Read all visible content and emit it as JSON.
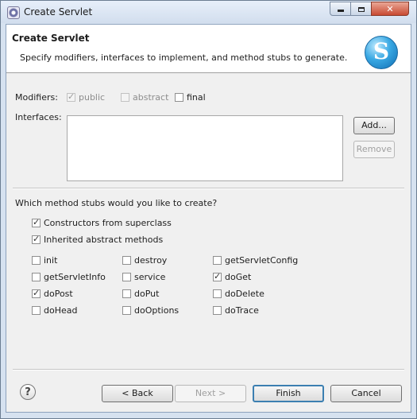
{
  "window": {
    "title": "Create Servlet",
    "controls": {
      "minimize": "",
      "maximize": "",
      "close": "✕"
    }
  },
  "banner": {
    "title": "Create Servlet",
    "description": "Specify modifiers, interfaces to implement, and method stubs to generate.",
    "logo_letter": "S"
  },
  "modifiers": {
    "label": "Modifiers:",
    "public": {
      "label": "public",
      "checked": true,
      "enabled": false
    },
    "abstract": {
      "label": "abstract",
      "checked": false,
      "enabled": false
    },
    "final": {
      "label": "final",
      "checked": false,
      "enabled": true
    }
  },
  "interfaces": {
    "label": "Interfaces:",
    "add_button": "Add...",
    "remove_button": "Remove"
  },
  "stubs": {
    "question": "Which method stubs would you like to create?",
    "constructors": {
      "label": "Constructors from superclass",
      "checked": true
    },
    "inherited": {
      "label": "Inherited abstract methods",
      "checked": true
    },
    "methods": [
      {
        "label": "init",
        "checked": false
      },
      {
        "label": "destroy",
        "checked": false
      },
      {
        "label": "getServletConfig",
        "checked": false
      },
      {
        "label": "getServletInfo",
        "checked": false
      },
      {
        "label": "service",
        "checked": false
      },
      {
        "label": "doGet",
        "checked": true
      },
      {
        "label": "doPost",
        "checked": true
      },
      {
        "label": "doPut",
        "checked": false
      },
      {
        "label": "doDelete",
        "checked": false
      },
      {
        "label": "doHead",
        "checked": false
      },
      {
        "label": "doOptions",
        "checked": false
      },
      {
        "label": "doTrace",
        "checked": false
      }
    ]
  },
  "footer": {
    "help": "?",
    "back": "< Back",
    "next": "Next >",
    "finish": "Finish",
    "cancel": "Cancel"
  }
}
